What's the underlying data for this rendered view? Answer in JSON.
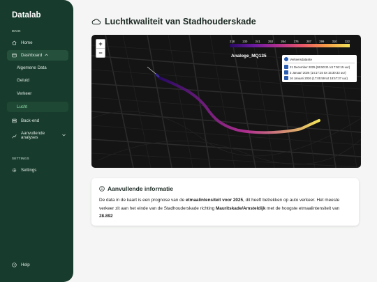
{
  "sidebar": {
    "brand": "Datalab",
    "section_main": "MAIN",
    "home": "Home",
    "dashboard": "Dashboard",
    "dashboard_sub": [
      "Algemene Data",
      "Geluid",
      "Verkeer",
      "Lucht"
    ],
    "backend": "Back-end",
    "analyses": "Aanvullende analyses",
    "section_settings": "SETTINGS",
    "settings": "Settings",
    "help": "Help"
  },
  "page": {
    "title": "Luchtkwaliteit van Stadhouderskade"
  },
  "map": {
    "zoom_in": "+",
    "zoom_out": "−",
    "legend_ticks": [
      "218",
      "230",
      "241",
      "253",
      "264",
      "276",
      "287",
      "299",
      "310",
      "322"
    ],
    "legend_title": "Analoge_MQ135",
    "layers": {
      "base": "Verkeersdatasite",
      "ranges": [
        "21 December 2025 (06:50:21 tot 7:52:15 uur)",
        "3 Januari 2026 (14:17:15 tot 15:30:33 uur)",
        "16 Januari 2026 (17:05:59 tot 18:57:37 uur)"
      ]
    },
    "colors": {
      "low": "#2a0a63",
      "mid": "#b0308f",
      "high": "#f2e35a"
    }
  },
  "info": {
    "title": "Aanvullende informatie",
    "p1": "De data in de kaart is een prognose van de ",
    "b1": "etmaalintensiteit voor 2025",
    "p2": ", dit heeft betrekken op auto verkeer. Het meeste verkeer zit aan het einde van de Stadhouderskade richting ",
    "b2": "Mauritskade/Amsteldijk",
    "p3": " met de hoogste etmaalintensiteit van ",
    "b3": "28.892"
  }
}
